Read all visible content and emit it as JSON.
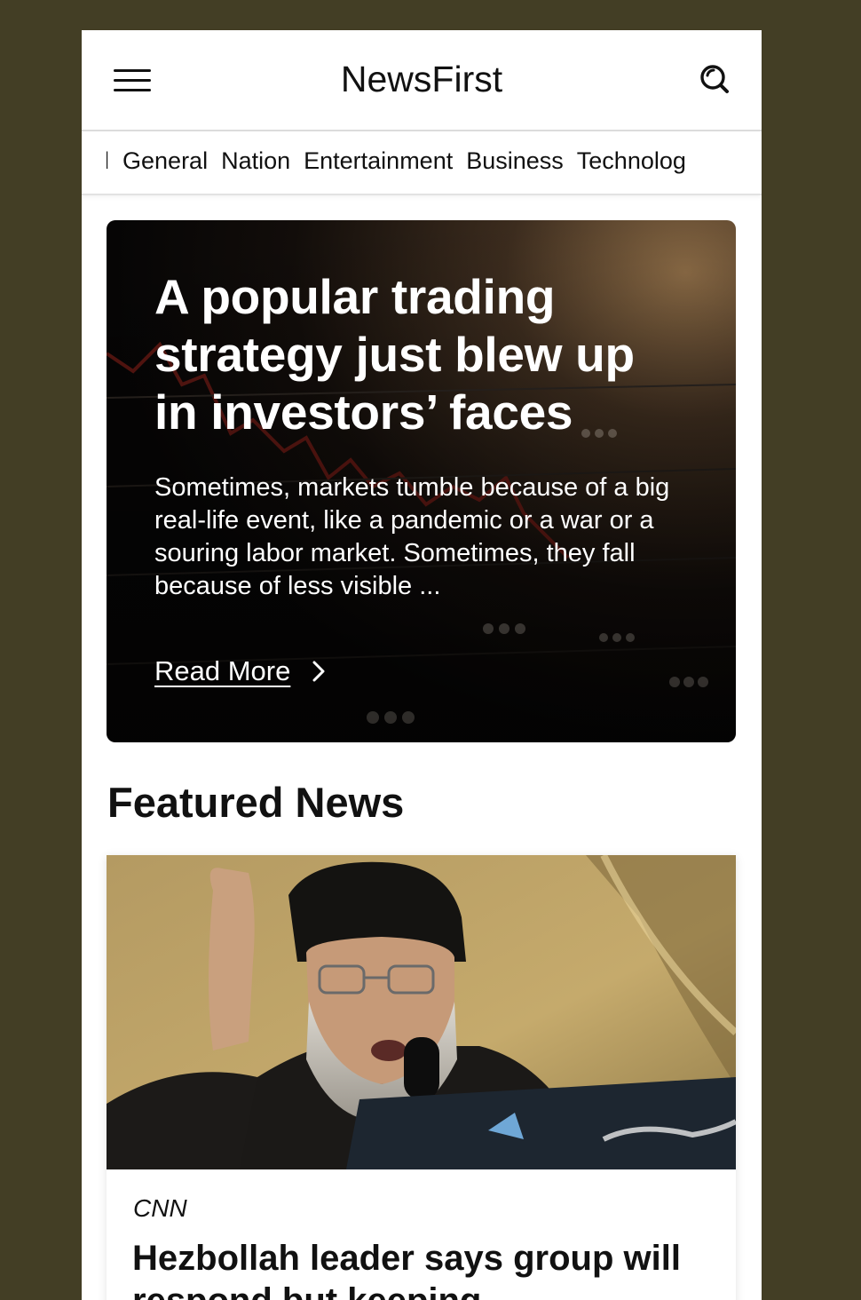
{
  "app": {
    "brand": "NewsFirst"
  },
  "categories": [
    "rld",
    "General",
    "Nation",
    "Entertainment",
    "Business",
    "Technolog"
  ],
  "hero": {
    "title": "A popular trading strategy just blew up in investors’ faces",
    "summary": "Sometimes, markets tumble because of a big real-life event, like a pandemic or a war or a souring labor market. Sometimes, they fall because of less visible ...",
    "read_more_label": "Read More",
    "image_subject": "stock market ticker board"
  },
  "featured": {
    "section_title": "Featured News",
    "items": [
      {
        "source": "CNN",
        "title": "Hezbollah leader says group will respond but keeping",
        "image_subject": "speaker at podium with microphone"
      }
    ]
  },
  "icons": {
    "menu": "hamburger-menu-icon",
    "search": "search-icon",
    "read_more": "chevron-right-icon"
  },
  "colors": {
    "page_background": "#433e25",
    "surface": "#ffffff",
    "text": "#111111",
    "hero_text": "#ffffff"
  }
}
